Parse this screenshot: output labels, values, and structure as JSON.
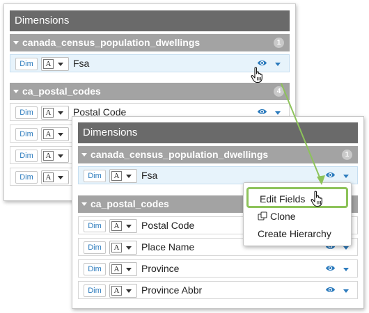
{
  "back_panel": {
    "title": "Dimensions",
    "groups": [
      {
        "name": "canada_census_population_dwellings",
        "count": "1",
        "rows": [
          {
            "dim": "Dim",
            "type": "A",
            "label": "Fsa",
            "selected": true
          }
        ]
      },
      {
        "name": "ca_postal_codes",
        "count": "4",
        "rows": [
          {
            "dim": "Dim",
            "type": "A",
            "label": "Postal Code"
          },
          {
            "dim": "Dim",
            "type": "A",
            "label": ""
          },
          {
            "dim": "Dim",
            "type": "A",
            "label": ""
          },
          {
            "dim": "Dim",
            "type": "A",
            "label": ""
          }
        ]
      }
    ]
  },
  "front_panel": {
    "title": "Dimensions",
    "groups": [
      {
        "name": "canada_census_population_dwellings",
        "count": "1",
        "rows": [
          {
            "dim": "Dim",
            "type": "A",
            "label": "Fsa",
            "selected": true
          }
        ]
      },
      {
        "name": "ca_postal_codes",
        "rows": [
          {
            "dim": "Dim",
            "type": "A",
            "label": "Postal Code"
          },
          {
            "dim": "Dim",
            "type": "A",
            "label": "Place Name"
          },
          {
            "dim": "Dim",
            "type": "A",
            "label": "Province"
          },
          {
            "dim": "Dim",
            "type": "A",
            "label": "Province Abbr"
          }
        ]
      }
    ]
  },
  "context_menu": {
    "items": [
      "Edit Fields",
      "Clone",
      "Create Hierarchy"
    ],
    "highlighted": "Edit Fields"
  },
  "colors": {
    "panel_header": "#6a6a6a",
    "group_header": "#a3a3a3",
    "accent_blue": "#2c7bbd",
    "selected_row": "#e7f3fb",
    "highlight_green": "#8dc35a"
  },
  "icons": [
    "eye-icon",
    "chevron-down-icon",
    "clone-icon",
    "hand-cursor-icon",
    "text-type-icon"
  ]
}
